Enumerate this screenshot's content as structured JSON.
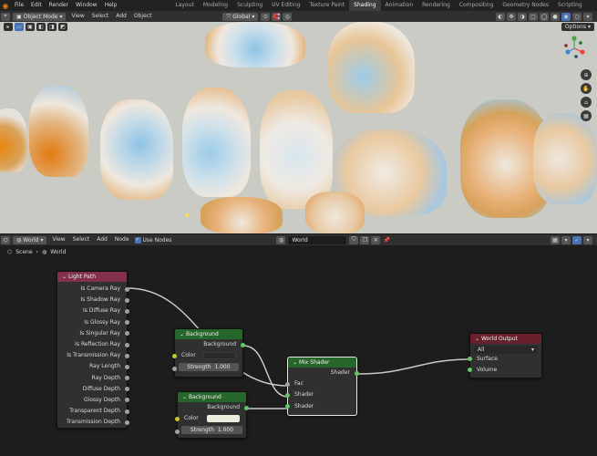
{
  "menu": {
    "file": "File",
    "edit": "Edit",
    "render": "Render",
    "window": "Window",
    "help": "Help"
  },
  "workspaces": [
    "Layout",
    "Modeling",
    "Sculpting",
    "UV Editing",
    "Texture Paint",
    "Shading",
    "Animation",
    "Rendering",
    "Compositing",
    "Geometry Nodes",
    "Scripting"
  ],
  "viewport_header": {
    "mode": "Object Mode",
    "view": "View",
    "select": "Select",
    "add": "Add",
    "object": "Object",
    "orientation": "Global",
    "options": "Options"
  },
  "node_header": {
    "editor_type": "World",
    "view": "View",
    "select": "Select",
    "add": "Add",
    "node": "Node",
    "use_nodes": "Use Nodes",
    "world_name": "World"
  },
  "breadcrumb": {
    "scene": "Scene",
    "world": "World"
  },
  "nodes": {
    "light_path": {
      "title": "Light Path",
      "outputs": [
        "Is Camera Ray",
        "Is Shadow Ray",
        "Is Diffuse Ray",
        "Is Glossy Ray",
        "Is Singular Ray",
        "Is Reflection Ray",
        "Is Transmission Ray",
        "Ray Length",
        "Ray Depth",
        "Diffuse Depth",
        "Glossy Depth",
        "Transparent Depth",
        "Transmission Depth"
      ]
    },
    "background1": {
      "title": "Background",
      "output": "Background",
      "color_label": "Color",
      "strength_label": "Strength",
      "strength_value": "1.000",
      "color": "#2a2a2a"
    },
    "background2": {
      "title": "Background",
      "output": "Background",
      "color_label": "Color",
      "strength_label": "Strength",
      "strength_value": "1.000",
      "color": "#ececdc"
    },
    "mix_shader": {
      "title": "Mix Shader",
      "output": "Shader",
      "fac": "Fac",
      "shader1": "Shader",
      "shader2": "Shader"
    },
    "world_output": {
      "title": "World Output",
      "target": "All",
      "surface": "Surface",
      "volume": "Volume"
    }
  },
  "colors": {
    "input_node_header": "#83314a",
    "shader_node_header": "#27662b",
    "output_node_header": "#6a1f2c",
    "viewport_bg": "#c9cbc4",
    "accent": "#4772b3"
  }
}
